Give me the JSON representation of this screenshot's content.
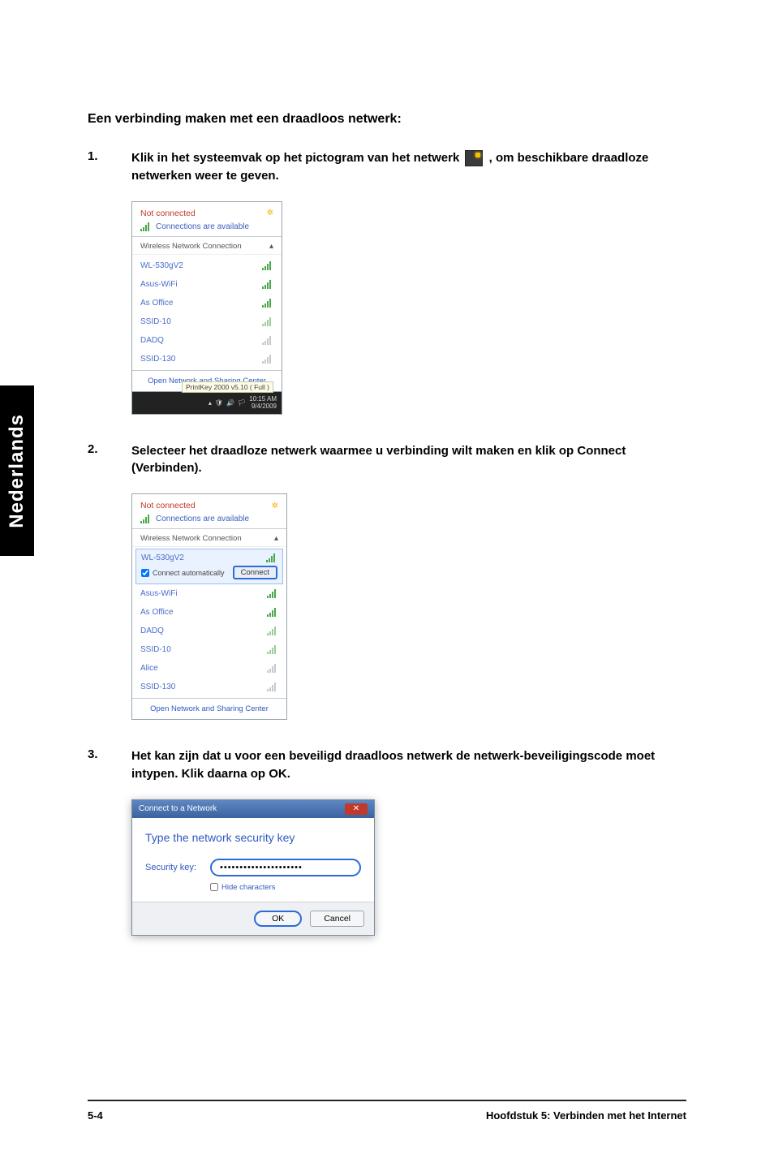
{
  "sideTab": "Nederlands",
  "heading": "Een verbinding maken met een draadloos netwerk:",
  "steps": {
    "s1": {
      "num": "1.",
      "pre": "Klik in het systeemvak op het pictogram van het netwerk ",
      "post": " , om beschikbare draadloze netwerken weer te geven."
    },
    "s2": {
      "num": "2.",
      "text": "Selecteer het draadloze netwerk waarmee u verbinding wilt maken en klik op ",
      "bold": "Connect (Verbinden)."
    },
    "s3": {
      "num": "3.",
      "text": "Het kan zijn dat u voor een beveiligd draadloos netwerk de netwerk-beveiligingscode moet intypen. Klik daarna op ",
      "bold": "OK."
    }
  },
  "fig1": {
    "title": "Not connected",
    "subtitle": "Connections are available",
    "groupHeader": "Wireless Network Connection",
    "networks": [
      "WL-530gV2",
      "Asus-WiFi",
      "As Office",
      "SSID-10",
      "DADQ",
      "SSID-130"
    ],
    "footerLink": "Open Network and Sharing Center",
    "trayTooltip": "PrintKey 2000 v5.10 ( Full )",
    "trayTime": "10:15 AM",
    "trayDate": "9/4/2009"
  },
  "fig2": {
    "title": "Not connected",
    "subtitle": "Connections are available",
    "groupHeader": "Wireless Network Connection",
    "selected": {
      "name": "WL-530gV2",
      "auto": "Connect automatically",
      "connect": "Connect"
    },
    "rest": [
      "Asus-WiFi",
      "As Office",
      "DADQ",
      "SSID-10",
      "Alice",
      "SSID-130"
    ],
    "footerLink": "Open Network and Sharing Center"
  },
  "fig3": {
    "windowTitle": "Connect to a Network",
    "heading": "Type the network security key",
    "label": "Security key:",
    "value": "•••••••••••••••••••••",
    "hide": "Hide characters",
    "ok": "OK",
    "cancel": "Cancel"
  },
  "footer": {
    "page": "5-4",
    "chapter": "Hoofdstuk 5: Verbinden met het Internet"
  }
}
